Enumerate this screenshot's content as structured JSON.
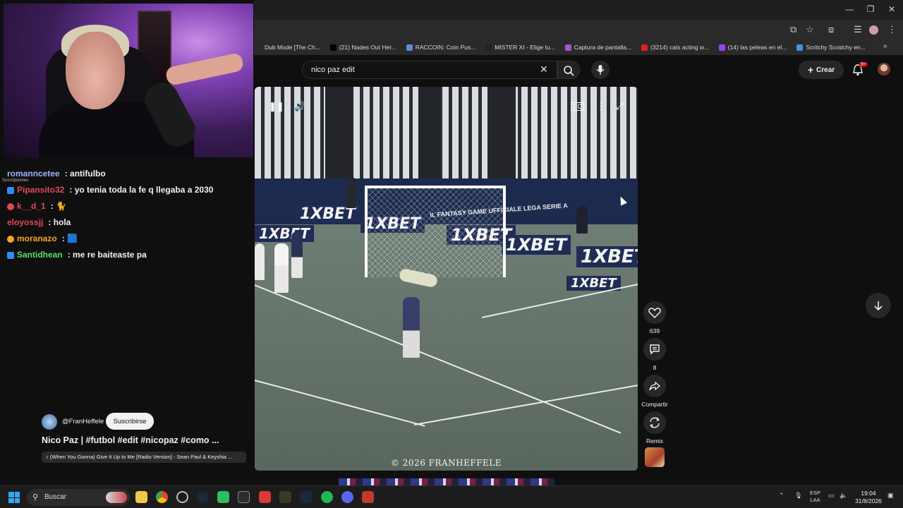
{
  "browser": {
    "bookmarks": [
      {
        "label": "Dub Mode [The Ch...",
        "color": "#2a2a2a"
      },
      {
        "label": "(21) Nades Out Her...",
        "color": "#000000"
      },
      {
        "label": "RACCOIN: Coin Pus...",
        "color": "#5a8de0"
      },
      {
        "label": "MISTER XI - Elige tu...",
        "color": "#222222"
      },
      {
        "label": "Captura de pantalla...",
        "color": "#9b59d0"
      },
      {
        "label": "(3214) cats acting w...",
        "color": "#e01f1f"
      },
      {
        "label": "(14) las peleas en el...",
        "color": "#9146ff"
      },
      {
        "label": "Scritchy Scratchy en...",
        "color": "#4a8fe8"
      }
    ]
  },
  "youtube": {
    "search_value": "nico paz edit",
    "create_label": "Crear",
    "notifications_badge": "9+"
  },
  "chat": {
    "messages": [
      {
        "user": "romanncetee",
        "message": ": antifulbo",
        "color": "#9fb4ff",
        "badge": "none"
      },
      {
        "user": "Pipansito32",
        "message": ": yo tenia toda la fe q llegaba a 2030",
        "color": "#e04858",
        "badge": "prime"
      },
      {
        "user": "k__d_1",
        "message": ": 🐈",
        "color": "#e04858",
        "badge": "circle"
      },
      {
        "user": "eloyossjj",
        "message": ": hola",
        "color": "#e04858",
        "badge": "none"
      },
      {
        "user": "moranazo",
        "message": ": 🟦",
        "color": "#f5a623",
        "badge": "gold"
      },
      {
        "user": "Santidhean",
        "message": ": me re baiteaste pa",
        "color": "#58e06a",
        "badge": "prime"
      }
    ],
    "subs_label": "Suscripciones"
  },
  "short": {
    "channel": "@FranHeffele",
    "subscribe_label": "Suscribirse",
    "title": "Nico Paz | #futbol #edit #nicopaz #como ...",
    "music": "♪ (When You Gonna) Give It Up to Me [Radio Version] - Sean Paul & Keyshia ...",
    "watermark": "© 2026 FRANHEFFELE",
    "ad_text": "1XBET",
    "goal_banner": "IL FANTASY GAME UFFICIALE LEGA SERIE A",
    "likes": "639",
    "comments": "8",
    "share_label": "Compartir",
    "remix_label": "Remix"
  },
  "taskbar": {
    "search_placeholder": "Buscar",
    "lang_top": "ESP",
    "lang_bottom": "LAA",
    "time": "19:04",
    "date": "31/8/2026"
  }
}
